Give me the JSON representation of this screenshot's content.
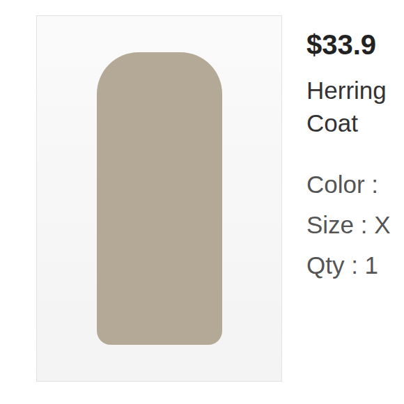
{
  "product": {
    "image": {
      "alt": "product photo"
    },
    "price": "$33.9",
    "title_lines": [
      "Herring",
      "Coat"
    ],
    "details": [
      "Color :",
      "Size : X",
      "Qty : 1"
    ]
  }
}
